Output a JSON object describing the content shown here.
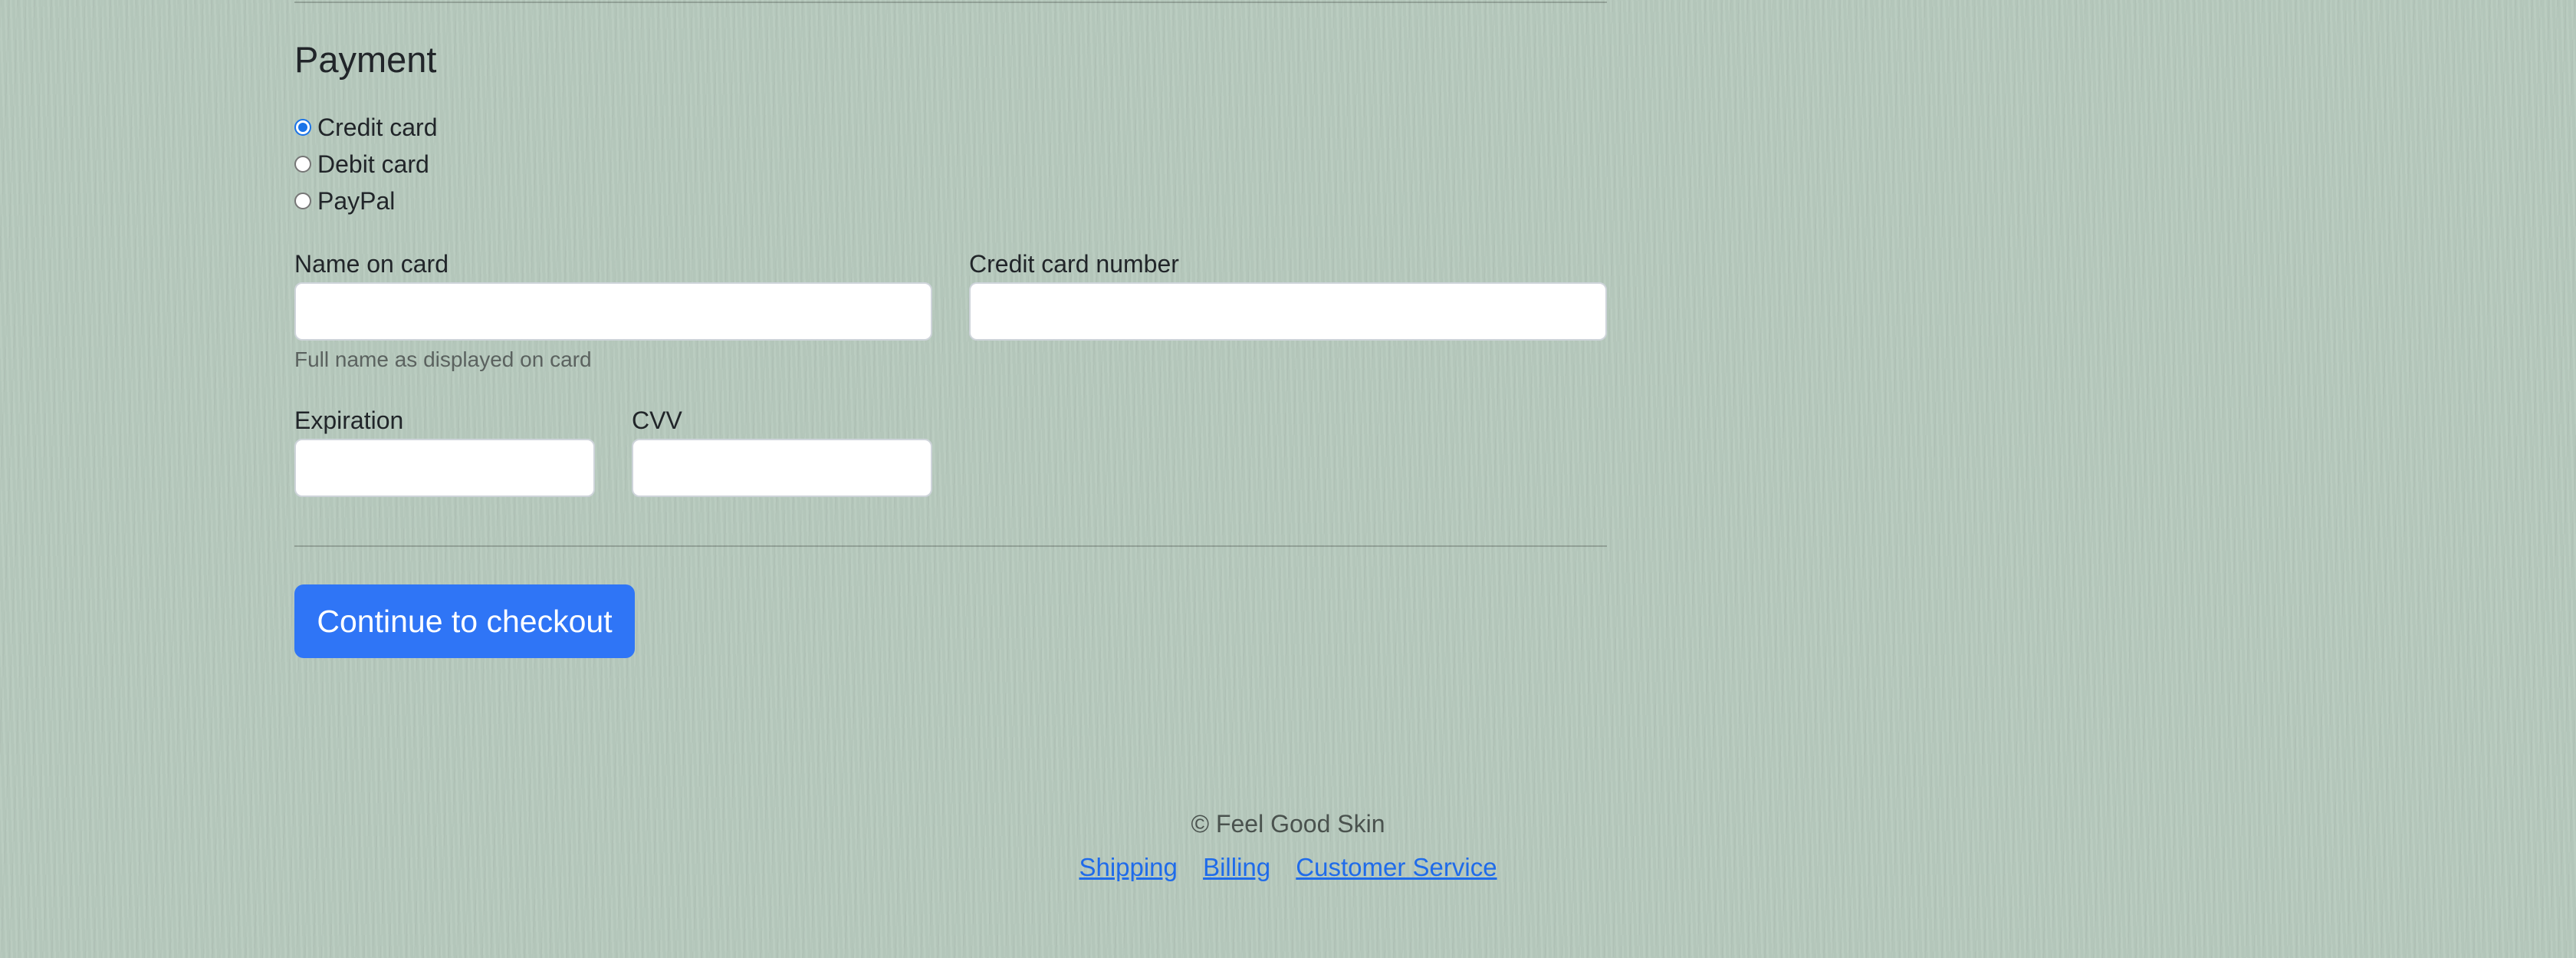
{
  "payment": {
    "heading": "Payment",
    "methods": [
      {
        "label": "Credit card",
        "checked": true
      },
      {
        "label": "Debit card",
        "checked": false
      },
      {
        "label": "PayPal",
        "checked": false
      }
    ],
    "fields": {
      "name_on_card": {
        "label": "Name on card",
        "value": "",
        "help": "Full name as displayed on card"
      },
      "card_number": {
        "label": "Credit card number",
        "value": ""
      },
      "expiration": {
        "label": "Expiration",
        "value": ""
      },
      "cvv": {
        "label": "CVV",
        "value": ""
      }
    },
    "submit_label": "Continue to checkout"
  },
  "footer": {
    "copyright": "© Feel Good Skin",
    "links": [
      "Shipping",
      "Billing",
      "Customer Service"
    ]
  },
  "colors": {
    "background": "#b6c9bd",
    "primary": "#2f75f6",
    "link": "#1f6bea"
  }
}
